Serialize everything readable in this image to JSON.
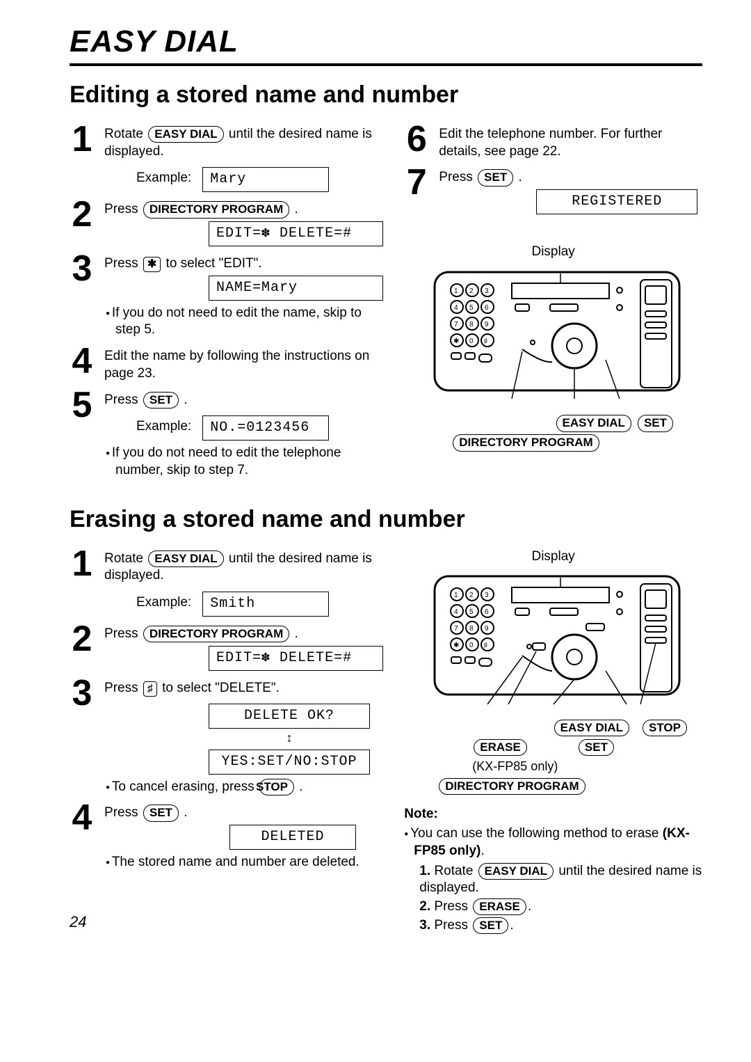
{
  "chapterTitle": "EASY DIAL",
  "pageNumber": "24",
  "buttons": {
    "easyDial": "EASY DIAL",
    "directoryProgram": "DIRECTORY PROGRAM",
    "set": "SET",
    "stop": "STOP",
    "erase": "ERASE"
  },
  "keys": {
    "star": "✱",
    "hash": "♯"
  },
  "sectionA": {
    "title": "Editing a stored name and number",
    "steps": {
      "s1": {
        "num": "1",
        "textA": "Rotate ",
        "textB": " until the desired name is displayed.",
        "exampleLabel": "Example:",
        "display": "Mary"
      },
      "s2": {
        "num": "2",
        "textA": "Press ",
        "textB": " .",
        "display": "EDIT=✽ DELETE=#"
      },
      "s3": {
        "num": "3",
        "textA": "Press ",
        "textB": " to select \"EDIT\".",
        "display": "NAME=Mary",
        "bullet": "If you do not need to edit the name, skip to step 5."
      },
      "s4": {
        "num": "4",
        "text": "Edit the name by following the instructions on page 23."
      },
      "s5": {
        "num": "5",
        "textA": "Press ",
        "textB": " .",
        "exampleLabel": "Example:",
        "display": "NO.=0123456",
        "bullet": "If you do not need to edit the telephone number, skip to step 7."
      },
      "s6": {
        "num": "6",
        "text": "Edit the telephone number. For further details, see page 22."
      },
      "s7": {
        "num": "7",
        "textA": "Press ",
        "textB": " .",
        "display": "REGISTERED"
      }
    },
    "displayLabel": "Display"
  },
  "sectionB": {
    "title": "Erasing a stored name and number",
    "steps": {
      "s1": {
        "num": "1",
        "textA": "Rotate ",
        "textB": " until the desired name is displayed.",
        "exampleLabel": "Example:",
        "display": "Smith"
      },
      "s2": {
        "num": "2",
        "textA": "Press ",
        "textB": " .",
        "display": "EDIT=✽ DELETE=#"
      },
      "s3": {
        "num": "3",
        "textA": "Press ",
        "textB": " to select \"DELETE\".",
        "display1": "DELETE OK?",
        "display2": "YES:SET/NO:STOP",
        "bulletA": "To cancel erasing, press ",
        "bulletB": " ."
      },
      "s4": {
        "num": "4",
        "textA": "Press ",
        "textB": " .",
        "display": "DELETED",
        "bullet": "The stored name and number are deleted."
      }
    },
    "displayLabel": "Display",
    "kxNote": "(KX-FP85 only)",
    "note": {
      "heading": "Note:",
      "lineA": "You can use the following method to erase ",
      "lineBold": "(KX-FP85 only)",
      "lineB": ".",
      "ol1a": "Rotate ",
      "ol1b": " until the desired name is displayed.",
      "ol2a": "Press ",
      "ol2b": ".",
      "ol3a": "Press ",
      "ol3b": "."
    }
  }
}
